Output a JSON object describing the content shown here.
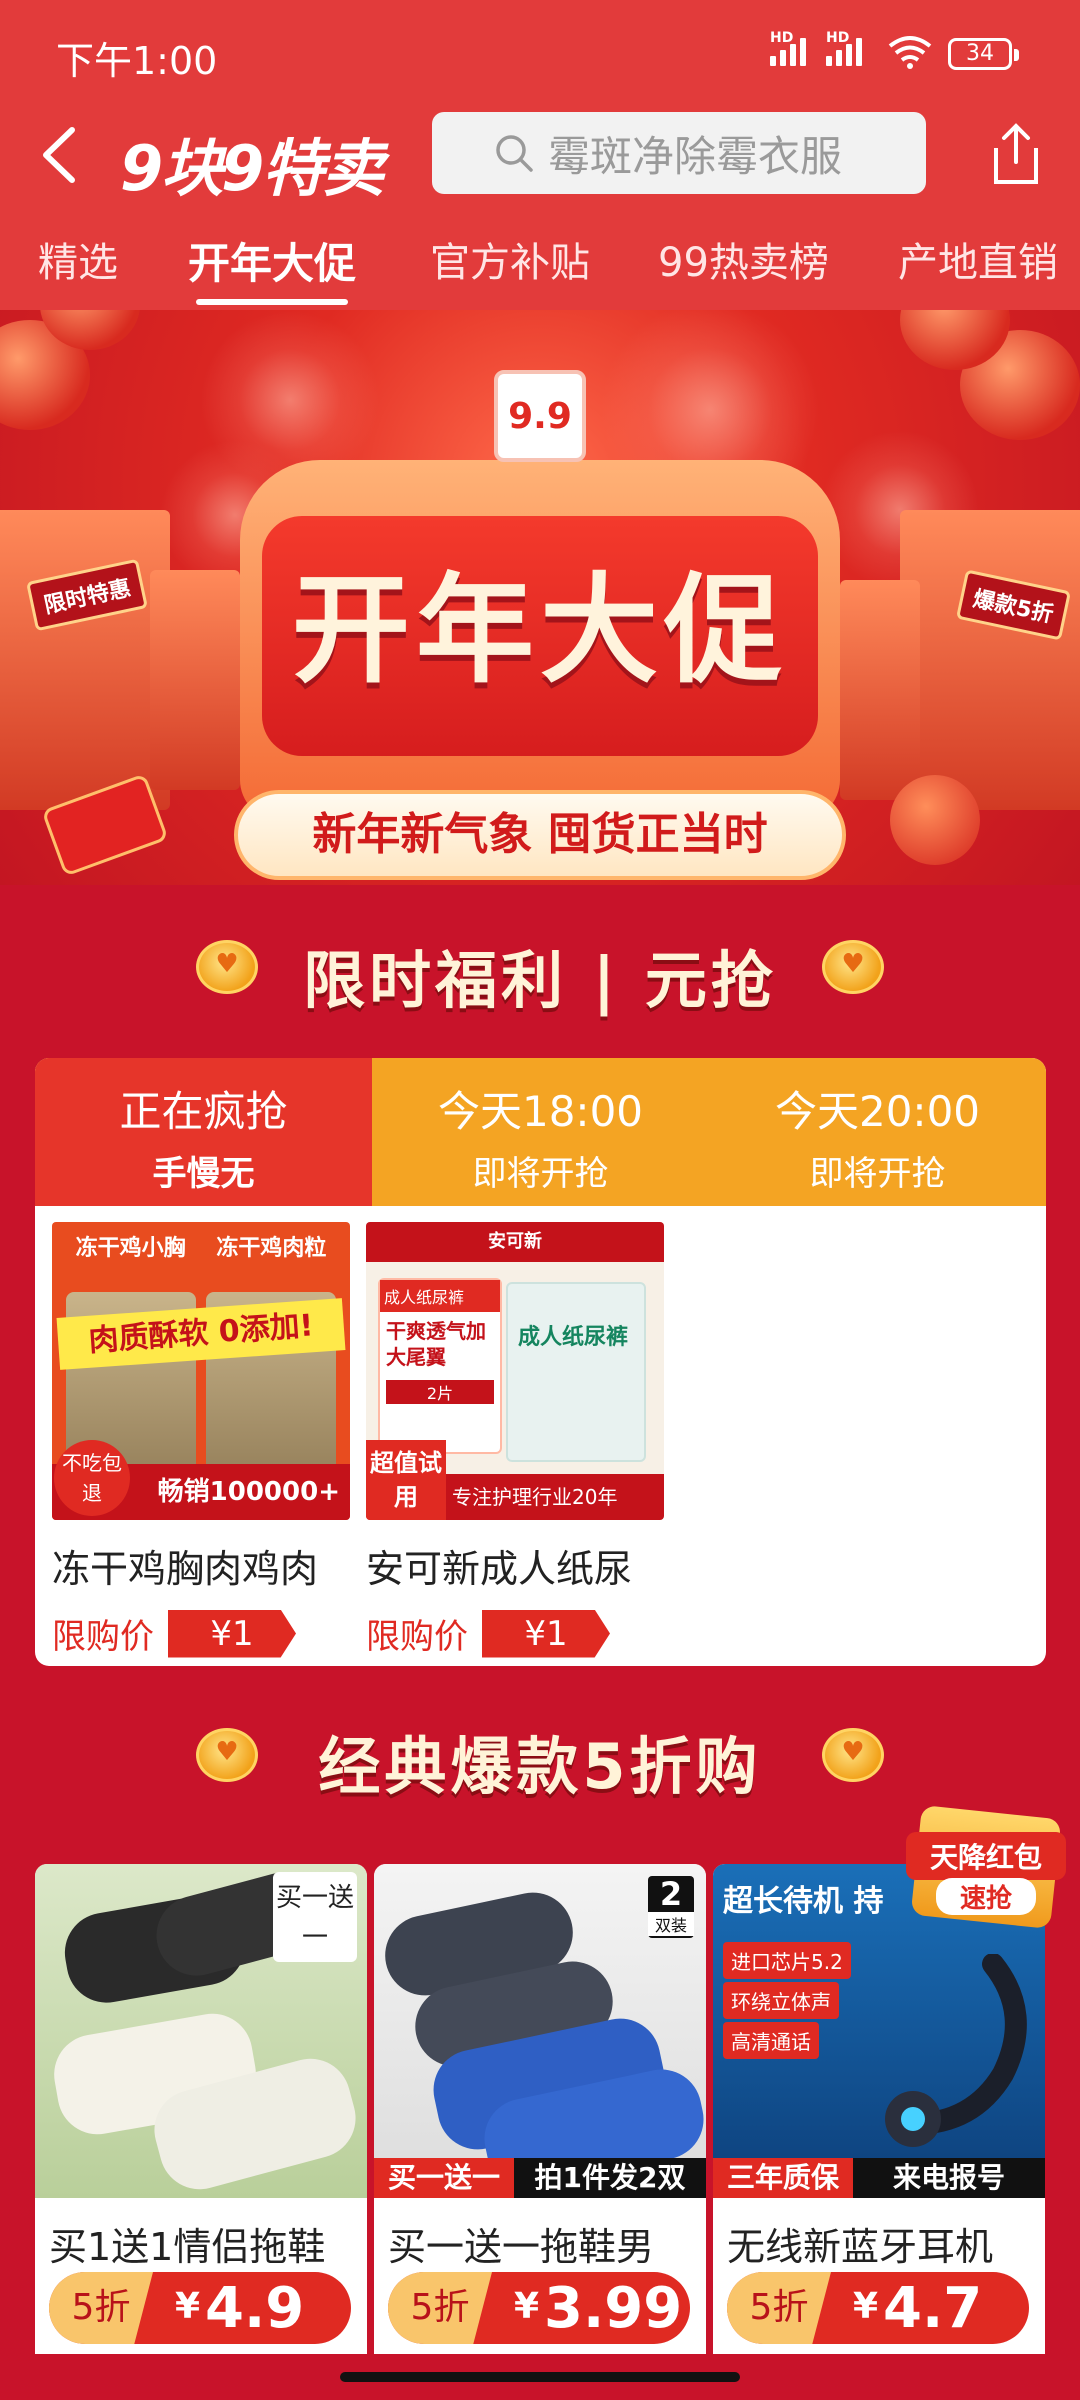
{
  "status_bar": {
    "time": "下午1:00",
    "battery": "34",
    "hd": "HD"
  },
  "header": {
    "logo_a": "9块9",
    "logo_b": "特卖",
    "search_placeholder": "霉斑净除霉衣服"
  },
  "tabs": [
    "精选",
    "开年大促",
    "官方补贴",
    "99热卖榜",
    "产地直销"
  ],
  "hero": {
    "badge": "9.9",
    "title": "开年大促",
    "subtitle": "新年新气象 囤货正当时",
    "left_sign": "限时特惠",
    "right_sign": "爆款5折"
  },
  "section1": {
    "title": "限时福利 | 元抢"
  },
  "flash_tabs": [
    {
      "t1": "正在疯抢",
      "t2": "手慢无"
    },
    {
      "t1": "今天18:00",
      "t2": "即将开抢"
    },
    {
      "t1": "今天20:00",
      "t2": "即将开抢"
    }
  ],
  "flash_items": [
    {
      "name": "冻干鸡胸肉鸡肉",
      "price_label": "限购价",
      "price": "¥1",
      "img": {
        "top_left": "冻干鸡小胸",
        "top_right": "冻干鸡肉粒",
        "banner": "肉质酥软 0添加!",
        "circle": "不吃包退",
        "bottom": "畅销100000+"
      }
    },
    {
      "name": "安可新成人纸尿",
      "price_label": "限购价",
      "price": "¥1",
      "img": {
        "brand": "安可新",
        "card_head": "成人纸尿裤",
        "card_text": "干爽透气加大尾翼",
        "card_count": "2片",
        "pack_text": "成人纸尿裤",
        "tag": "超值试用",
        "bottom": "专注护理行业20年"
      }
    }
  ],
  "section2": {
    "title": "经典爆款5折购"
  },
  "red_badge": {
    "top": "天降红包",
    "bottom": "速抢"
  },
  "products": [
    {
      "name": "买1送1情侣拖鞋",
      "discount": "5折",
      "yen": "¥",
      "price": "4.9",
      "corner": "买一送一"
    },
    {
      "name": "买一送一拖鞋男",
      "discount": "5折",
      "yen": "¥",
      "price": "3.99",
      "corner_num": "2",
      "corner_text": "双装",
      "strip_a": "买一送一",
      "strip_b": "拍1件发2双"
    },
    {
      "name": "无线新蓝牙耳机",
      "discount": "5折",
      "yen": "¥",
      "price": "4.7",
      "headline": "超长待机 持",
      "features": [
        "进口芯片5.2",
        "环绕立体声",
        "高清通话"
      ],
      "strip_a": "三年质保",
      "strip_b": "来电报号"
    }
  ]
}
